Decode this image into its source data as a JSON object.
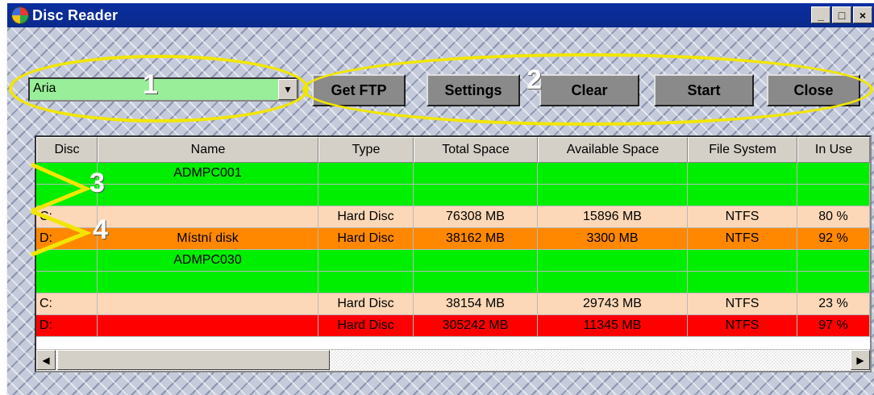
{
  "window": {
    "title": "Disc Reader",
    "controls": {
      "minimize": "_",
      "maximize": "□",
      "close": "×"
    }
  },
  "combo": {
    "value": "Aria"
  },
  "buttons": {
    "get_ftp": "Get FTP",
    "settings": "Settings",
    "clear": "Clear",
    "start": "Start",
    "close": "Close"
  },
  "callouts": [
    "1",
    "2",
    "3",
    "4"
  ],
  "table": {
    "columns": [
      "Disc",
      "Name",
      "Type",
      "Total Space",
      "Available Space",
      "File System",
      "In Use"
    ],
    "rows": [
      {
        "cells": [
          "",
          "ADMPC001",
          "",
          "",
          "",
          "",
          ""
        ],
        "color": "#00ee00"
      },
      {
        "cells": [
          "",
          "",
          "",
          "",
          "",
          "",
          ""
        ],
        "color": "#00ee00"
      },
      {
        "cells": [
          "C:",
          "",
          "Hard Disc",
          "76308 MB",
          "15896 MB",
          "NTFS",
          "80 %"
        ],
        "color": "#fcd8b8"
      },
      {
        "cells": [
          "D:",
          "Místní disk",
          "Hard Disc",
          "38162 MB",
          "3300 MB",
          "NTFS",
          "92 %"
        ],
        "color": "#ff8800"
      },
      {
        "cells": [
          "",
          "ADMPC030",
          "",
          "",
          "",
          "",
          ""
        ],
        "color": "#00ee00"
      },
      {
        "cells": [
          "",
          "",
          "",
          "",
          "",
          "",
          ""
        ],
        "color": "#00ee00"
      },
      {
        "cells": [
          "C:",
          "",
          "Hard Disc",
          "38154 MB",
          "29743 MB",
          "NTFS",
          "23 %"
        ],
        "color": "#fcd8b8"
      },
      {
        "cells": [
          "D:",
          "",
          "Hard Disc",
          "305242 MB",
          "11345 MB",
          "NTFS",
          "97 %"
        ],
        "color": "#ff0000"
      }
    ]
  },
  "colors": {
    "highlight": "#f2e600",
    "titlebar": "#0a2a8c",
    "combo_bg": "#99ee99",
    "button_bg": "#8a8a8a"
  },
  "icons": {
    "app": "disc-reader-app-icon",
    "combo_arrow": "chevron-down-icon",
    "scroll_left": "arrow-left-icon",
    "scroll_right": "arrow-right-icon"
  }
}
